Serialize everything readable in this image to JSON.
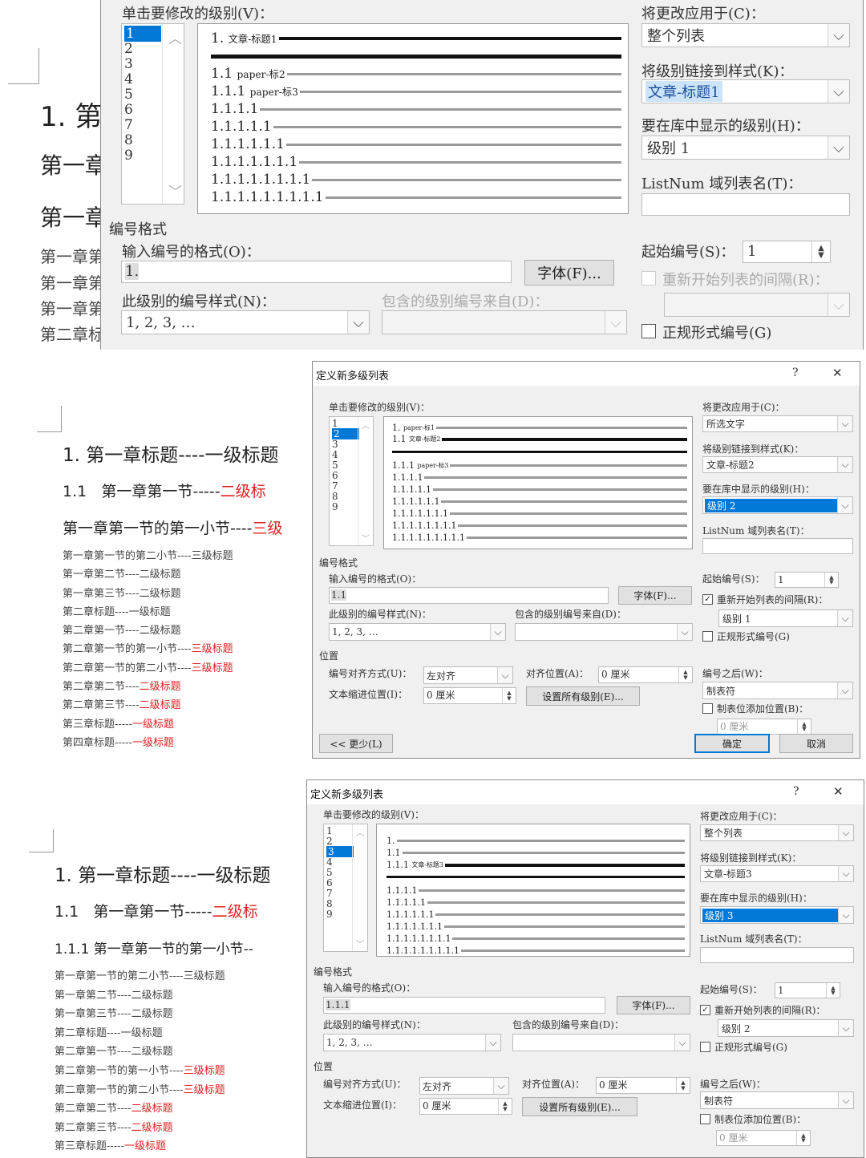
{
  "section1": {
    "doc_lines": [
      "1. 第",
      "第一章",
      "第一章",
      "第一章第",
      "第一章第",
      "第一章第",
      "第二章标"
    ],
    "label_level": "单击要修改的级别(V)：",
    "levels": [
      "1",
      "2",
      "3",
      "4",
      "5",
      "6",
      "7",
      "8",
      "9"
    ],
    "preview": [
      {
        "n": "1.",
        "s": "文章-标题1"
      },
      {
        "n": "1.1",
        "s": "paper-标2"
      },
      {
        "n": "1.1.1",
        "s": "paper-标3"
      },
      {
        "n": "1.1.1.1",
        "s": ""
      },
      {
        "n": "1.1.1.1.1",
        "s": ""
      },
      {
        "n": "1.1.1.1.1.1",
        "s": ""
      },
      {
        "n": "1.1.1.1.1.1.1",
        "s": ""
      },
      {
        "n": "1.1.1.1.1.1.1.1",
        "s": ""
      },
      {
        "n": "1.1.1.1.1.1.1.1.1",
        "s": ""
      }
    ],
    "apply_label": "将更改应用于(C)：",
    "apply_value": "整个列表",
    "link_label": "将级别链接到样式(K)：",
    "link_value": "文章-标题1",
    "gallery_label": "要在库中显示的级别(H)：",
    "gallery_value": "级别 1",
    "listnum_label": "ListNum 域列表名(T)：",
    "numfmt_group": "编号格式",
    "enter_fmt_label": "输入编号的格式(O)：",
    "enter_fmt_value": "1.",
    "font_btn": "字体(F)...",
    "style_label": "此级别的编号样式(N)：",
    "style_value": "1, 2, 3, …",
    "include_label": "包含的级别编号来自(D)：",
    "start_label": "起始编号(S)：",
    "start_value": "1",
    "restart_label": "重新开始列表的间隔(R)：",
    "legal_label": "正规形式编号(G)"
  },
  "section2": {
    "title": "定义新多级列表",
    "help": "?",
    "close": "✕",
    "h1": "1. 第一章标题----一级标题",
    "h2_num": "1.1",
    "h2_text": "第一章第一节-----",
    "h2_red": "二级标",
    "h3_text": "第一章第一节的第一小节----",
    "h3_red": "三级",
    "lines": [
      {
        "t": "第一章第一节的第二小节----三级标题",
        "r": ""
      },
      {
        "t": "第一章第二节----二级标题",
        "r": ""
      },
      {
        "t": "第一章第三节----二级标题",
        "r": ""
      },
      {
        "t": "第二章标题----一级标题",
        "r": ""
      },
      {
        "t": "第二章第一节----二级标题",
        "r": ""
      },
      {
        "t": "第二章第一节的第一小节----",
        "r": "三级标题"
      },
      {
        "t": "第二章第一节的第二小节----",
        "r": "三级标题"
      },
      {
        "t": "第二章第二节----",
        "r": "二级标题"
      },
      {
        "t": "第二章第三节----",
        "r": "二级标题"
      },
      {
        "t": "第三章标题-----",
        "r": "一级标题"
      },
      {
        "t": "第四章标题-----",
        "r": "一级标题"
      }
    ],
    "label_level": "单击要修改的级别(V)：",
    "levels": [
      "1",
      "2",
      "3",
      "4",
      "5",
      "6",
      "7",
      "8",
      "9"
    ],
    "preview": [
      {
        "n": "1.",
        "s": "paper-标1"
      },
      {
        "n": "1.1",
        "s": "文章-标题2"
      },
      {
        "n": "1.1.1",
        "s": "paper-标3"
      },
      {
        "n": "1.1.1.1",
        "s": ""
      },
      {
        "n": "1.1.1.1.1",
        "s": ""
      },
      {
        "n": "1.1.1.1.1.1",
        "s": ""
      },
      {
        "n": "1.1.1.1.1.1.1",
        "s": ""
      },
      {
        "n": "1.1.1.1.1.1.1.1",
        "s": ""
      },
      {
        "n": "1.1.1.1.1.1.1.1.1",
        "s": ""
      }
    ],
    "apply_label": "将更改应用于(C)：",
    "apply_value": "所选文字",
    "link_label": "将级别链接到样式(K)：",
    "link_value": "文章-标题2",
    "gallery_label": "要在库中显示的级别(H)：",
    "gallery_value": "级别 2",
    "listnum_label": "ListNum 域列表名(T)：",
    "numfmt_group": "编号格式",
    "enter_fmt_label": "输入编号的格式(O)：",
    "enter_fmt_value": "1.1",
    "font_btn": "字体(F)...",
    "style_label": "此级别的编号样式(N)：",
    "style_value": "1, 2, 3, …",
    "include_label": "包含的级别编号来自(D)：",
    "start_label": "起始编号(S)：",
    "start_value": "1",
    "restart_label": "重新开始列表的间隔(R)：",
    "restart_value": "级别 1",
    "legal_label": "正规形式编号(G)",
    "pos_group": "位置",
    "align_label": "编号对齐方式(U)：",
    "align_value": "左对齐",
    "alignat_label": "对齐位置(A)：",
    "alignat_value": "0 厘米",
    "indent_label": "文本缩进位置(I)：",
    "indent_value": "0 厘米",
    "setall_btn": "设置所有级别(E)...",
    "follow_label": "编号之后(W)：",
    "follow_value": "制表符",
    "tabstop_label": "制表位添加位置(B)：",
    "tabstop_value": "0 厘米",
    "less_btn": "<< 更少(L)",
    "ok_btn": "确定",
    "cancel_btn": "取消"
  },
  "section3": {
    "title": "定义新多级列表",
    "help": "?",
    "close": "✕",
    "h1": "1. 第一章标题----一级标题",
    "h2_num": "1.1",
    "h2_text": "第一章第一节-----",
    "h2_red": "二级标",
    "h3_text": "1.1.1 第一章第一节的第一小节--",
    "lines": [
      {
        "t": "第一章第一节的第二小节----三级标题",
        "r": ""
      },
      {
        "t": "第一章第二节----二级标题",
        "r": ""
      },
      {
        "t": "第一章第三节----二级标题",
        "r": ""
      },
      {
        "t": "第二章标题----一级标题",
        "r": ""
      },
      {
        "t": "第二章第一节----二级标题",
        "r": ""
      },
      {
        "t": "第二章第一节的第一小节----",
        "r": "三级标题"
      },
      {
        "t": "第二章第一节的第二小节----",
        "r": "三级标题"
      },
      {
        "t": "第二章第二节----",
        "r": "二级标题"
      },
      {
        "t": "第二章第三节----",
        "r": "二级标题"
      },
      {
        "t": "第三章标题-----",
        "r": "一级标题"
      }
    ],
    "label_level": "单击要修改的级别(V)：",
    "levels": [
      "1",
      "2",
      "3",
      "4",
      "5",
      "6",
      "7",
      "8",
      "9"
    ],
    "preview": [
      {
        "n": "1.",
        "s": ""
      },
      {
        "n": "1.1",
        "s": ""
      },
      {
        "n": "1.1.1",
        "s": "文章-标题3"
      },
      {
        "n": "1.1.1.1",
        "s": ""
      },
      {
        "n": "1.1.1.1.1",
        "s": ""
      },
      {
        "n": "1.1.1.1.1.1",
        "s": ""
      },
      {
        "n": "1.1.1.1.1.1.1",
        "s": ""
      },
      {
        "n": "1.1.1.1.1.1.1.1",
        "s": ""
      },
      {
        "n": "1.1.1.1.1.1.1.1.1",
        "s": ""
      }
    ],
    "apply_label": "将更改应用于(C)：",
    "apply_value": "整个列表",
    "link_label": "将级别链接到样式(K)：",
    "link_value": "文章-标题3",
    "gallery_label": "要在库中显示的级别(H)：",
    "gallery_value": "级别 3",
    "listnum_label": "ListNum 域列表名(T)：",
    "numfmt_group": "编号格式",
    "enter_fmt_label": "输入编号的格式(O)：",
    "enter_fmt_value": "1.1.1",
    "font_btn": "字体(F)...",
    "style_label": "此级别的编号样式(N)：",
    "style_value": "1, 2, 3, …",
    "include_label": "包含的级别编号来自(D)：",
    "start_label": "起始编号(S)：",
    "start_value": "1",
    "restart_label": "重新开始列表的间隔(R)：",
    "restart_value": "级别 2",
    "legal_label": "正规形式编号(G)",
    "pos_group": "位置",
    "align_label": "编号对齐方式(U)：",
    "align_value": "左对齐",
    "alignat_label": "对齐位置(A)：",
    "alignat_value": "0 厘米",
    "indent_label": "文本缩进位置(I)：",
    "indent_value": "0 厘米",
    "setall_btn": "设置所有级别(E)...",
    "follow_label": "编号之后(W)：",
    "follow_value": "制表符",
    "tabstop_label": "制表位添加位置(B)：",
    "tabstop_value": "0 厘米"
  }
}
